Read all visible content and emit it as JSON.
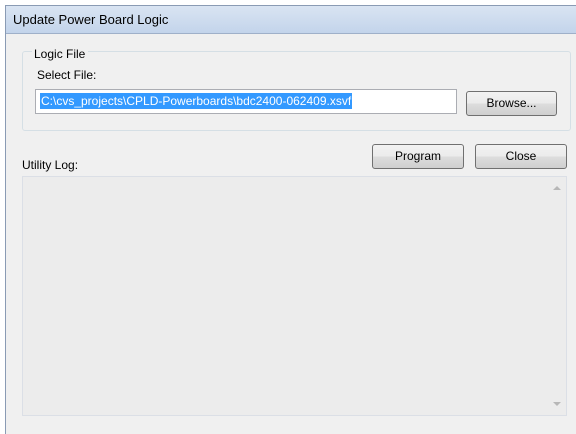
{
  "window": {
    "title": "Update Power Board Logic"
  },
  "logic_file": {
    "group_label": "Logic File",
    "select_label": "Select File:",
    "path_value": "C:\\cvs_projects\\CPLD-Powerboards\\bdc2400-062409.xsvf",
    "browse_label": "Browse..."
  },
  "actions": {
    "program_label": "Program",
    "close_label": "Close"
  },
  "log": {
    "label": "Utility Log:",
    "content": ""
  }
}
